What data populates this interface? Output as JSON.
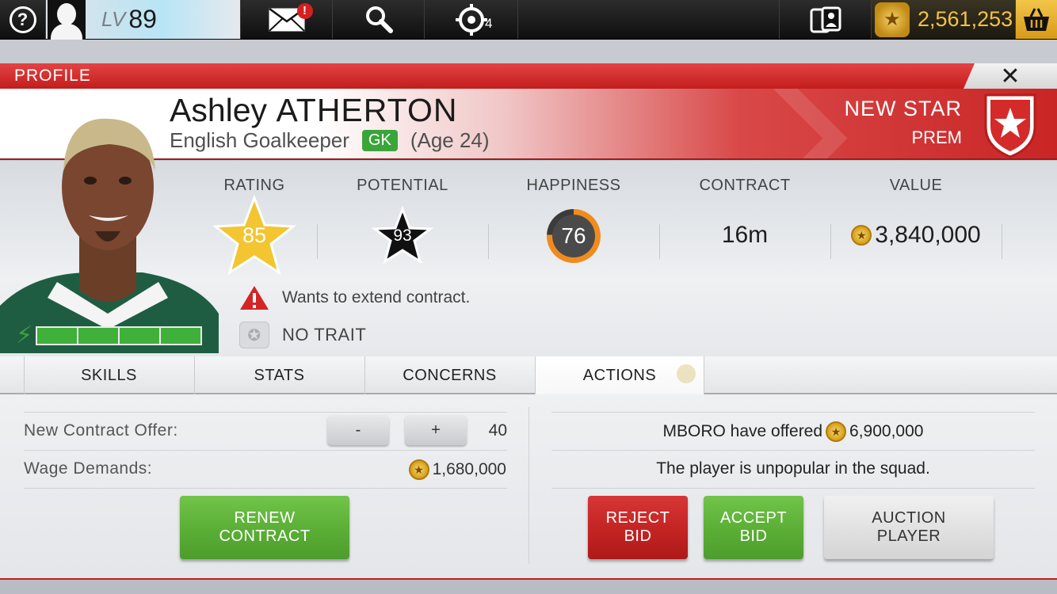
{
  "topbar": {
    "help_icon": "question-icon",
    "level_label": "LV",
    "level_value": "89",
    "mail_badge": "!",
    "target_count": "4",
    "coins": "2,561,253"
  },
  "header": {
    "title": "PROFILE",
    "close": "✕"
  },
  "player": {
    "first_name": "Ashley",
    "last_name": "ATHERTON",
    "nationality_position": "English Goalkeeper",
    "position_badge": "GK",
    "age": "(Age 24)",
    "star_type": "NEW STAR",
    "league": "PREM"
  },
  "stats": {
    "rating_label": "RATING",
    "rating": "85",
    "potential_label": "POTENTIAL",
    "potential": "93",
    "happiness_label": "HAPPINESS",
    "happiness": "76",
    "contract_label": "CONTRACT",
    "contract": "16m",
    "value_label": "VALUE",
    "value": "3,840,000"
  },
  "notices": {
    "warning": "Wants to extend contract.",
    "trait": "NO TRAIT"
  },
  "stamina": {
    "filled_segments": 4,
    "total_segments": 4
  },
  "tabs": [
    {
      "label": "SKILLS"
    },
    {
      "label": "STATS"
    },
    {
      "label": "CONCERNS"
    },
    {
      "label": "ACTIONS"
    }
  ],
  "actions": {
    "contract_offer_label": "New Contract Offer:",
    "minus": "-",
    "plus": "+",
    "contract_offer_value": "40",
    "wage_label": "Wage Demands:",
    "wage_value": "1,680,000",
    "renew_line1": "RENEW",
    "renew_line2": "CONTRACT",
    "bid_text_prefix": "MBORO have offered",
    "bid_value": "6,900,000",
    "squad_note": "The player is unpopular in the squad.",
    "reject_line1": "REJECT",
    "reject_line2": "BID",
    "accept_line1": "ACCEPT",
    "accept_line2": "BID",
    "auction_line1": "AUCTION",
    "auction_line2": "PLAYER"
  },
  "colors": {
    "accent_red": "#c92525",
    "accent_green": "#5aae35",
    "gold": "#f3c246"
  }
}
